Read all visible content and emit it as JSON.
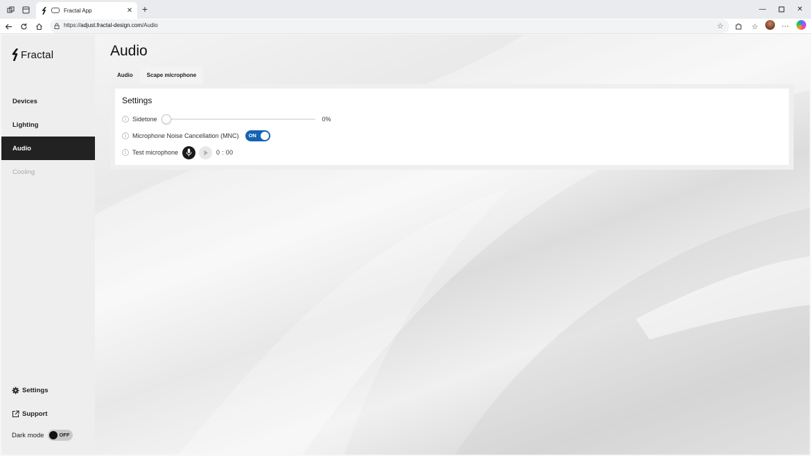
{
  "browser": {
    "tab_title": "Fractal App",
    "url_prefix": "https://",
    "url_host": "adjust.fractal-design.com",
    "url_path": "/Audio"
  },
  "sidebar": {
    "brand": "Fractal",
    "items": [
      {
        "label": "Devices",
        "state": "normal"
      },
      {
        "label": "Lighting",
        "state": "normal"
      },
      {
        "label": "Audio",
        "state": "active"
      },
      {
        "label": "Cooling",
        "state": "disabled"
      }
    ],
    "footer": {
      "settings_label": "Settings",
      "support_label": "Support",
      "dark_mode_label": "Dark mode",
      "dark_mode_state": "OFF"
    }
  },
  "main": {
    "title": "Audio",
    "tabs": [
      {
        "label": "Audio",
        "selected": false
      },
      {
        "label": "Scape microphone",
        "selected": true
      }
    ],
    "settings": {
      "heading": "Settings",
      "sidetone_label": "Sidetone",
      "sidetone_value": "0%",
      "sidetone_level": 0,
      "mnc_label": "Microphone Noise Cancellation (MNC)",
      "mnc_state": "ON",
      "test_label": "Test microphone",
      "timer": "0 : 00"
    }
  },
  "colors": {
    "accent": "#1464b4",
    "active_nav": "#222222"
  }
}
